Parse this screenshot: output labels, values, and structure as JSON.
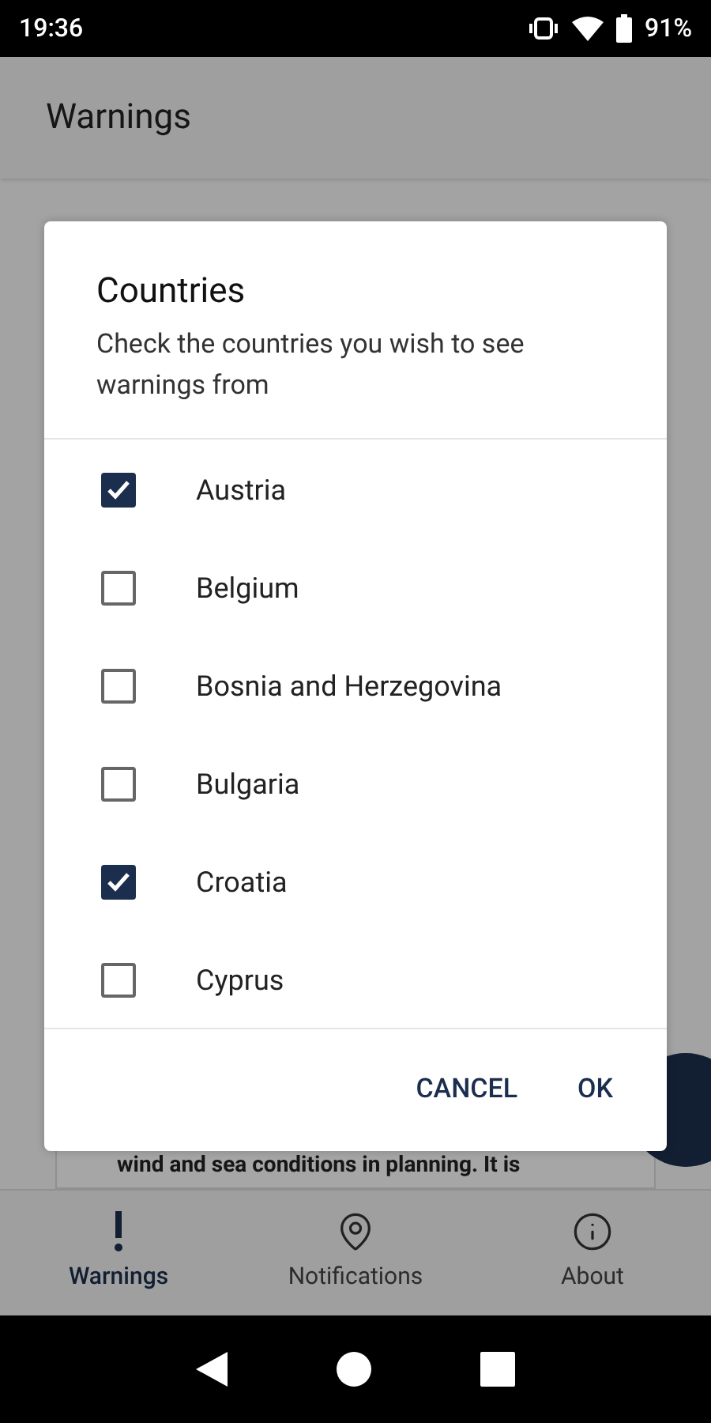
{
  "status_bar": {
    "time": "19:36",
    "battery": "91%"
  },
  "app_bar": {
    "title": "Warnings"
  },
  "background_card": {
    "text": "wind and sea conditions in planning. It is"
  },
  "dialog": {
    "title": "Countries",
    "message": "Check the countries you wish to see warnings from",
    "countries": [
      {
        "label": "Austria",
        "checked": true
      },
      {
        "label": "Belgium",
        "checked": false
      },
      {
        "label": "Bosnia and Herzegovina",
        "checked": false
      },
      {
        "label": "Bulgaria",
        "checked": false
      },
      {
        "label": "Croatia",
        "checked": true
      },
      {
        "label": "Cyprus",
        "checked": false
      }
    ],
    "buttons": [
      "CANCEL",
      "OK"
    ]
  },
  "bottom_nav": [
    {
      "label": "Warnings",
      "kind": "exclamation",
      "selected": true
    },
    {
      "label": "Notifications",
      "kind": "pin",
      "selected": false
    },
    {
      "label": "About",
      "kind": "info",
      "selected": false
    }
  ]
}
